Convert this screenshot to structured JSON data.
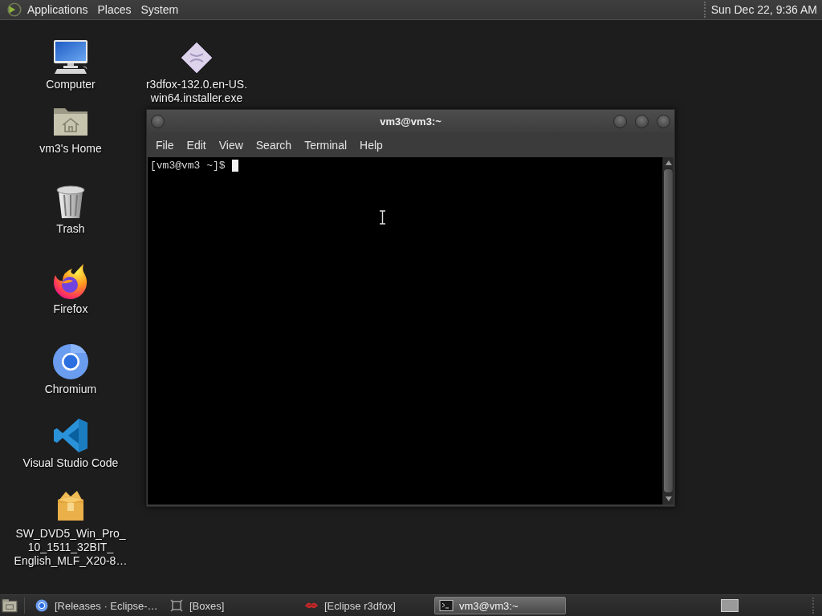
{
  "top_panel": {
    "menus": [
      "Applications",
      "Places",
      "System"
    ],
    "clock": "Sun Dec 22, 9:36 AM"
  },
  "desktop_icons": [
    {
      "kind": "computer",
      "label_lines": [
        "Computer"
      ]
    },
    {
      "kind": "installer",
      "label_lines": [
        "r3dfox-132.0.en-US.",
        "win64.installer.exe"
      ]
    },
    {
      "kind": "home",
      "label_lines": [
        "vm3's Home"
      ]
    },
    {
      "kind": "trash",
      "label_lines": [
        "Trash"
      ]
    },
    {
      "kind": "firefox",
      "label_lines": [
        "Firefox"
      ]
    },
    {
      "kind": "chromium",
      "label_lines": [
        "Chromium"
      ]
    },
    {
      "kind": "vscode",
      "label_lines": [
        "Visual Studio Code"
      ]
    },
    {
      "kind": "package",
      "label_lines": [
        "SW_DVD5_Win_Pro_",
        "10_1511_32BIT_",
        "English_MLF_X20-8…"
      ]
    }
  ],
  "terminal_window": {
    "title": "vm3@vm3:~",
    "menus": [
      "File",
      "Edit",
      "View",
      "Search",
      "Terminal",
      "Help"
    ],
    "prompt": "[vm3@vm3 ~]$"
  },
  "taskbar": {
    "tasks": [
      {
        "kind": "browser",
        "label": "[Releases · Eclipse-…",
        "selected": false
      },
      {
        "kind": "boxes",
        "label": "[Boxes]",
        "selected": false
      },
      {
        "kind": "r3dfox",
        "label": "[Eclipse r3dfox]",
        "selected": false
      },
      {
        "kind": "terminal",
        "label": "vm3@vm3:~",
        "selected": true
      }
    ]
  }
}
